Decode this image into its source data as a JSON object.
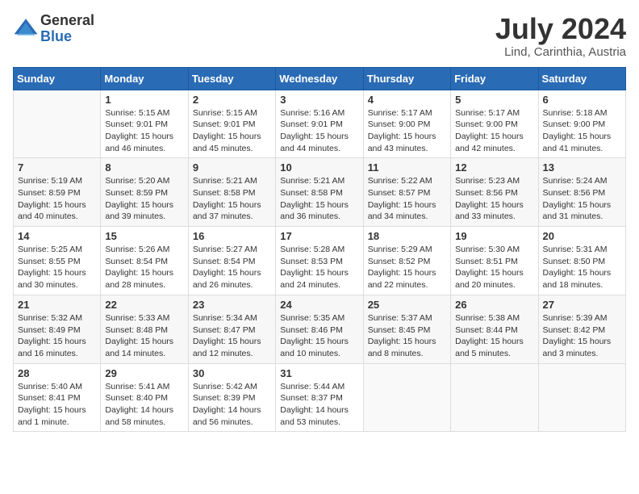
{
  "header": {
    "logo_general": "General",
    "logo_blue": "Blue",
    "month_title": "July 2024",
    "location": "Lind, Carinthia, Austria"
  },
  "days_of_week": [
    "Sunday",
    "Monday",
    "Tuesday",
    "Wednesday",
    "Thursday",
    "Friday",
    "Saturday"
  ],
  "weeks": [
    [
      {
        "day": "",
        "empty": true
      },
      {
        "day": "1",
        "sunrise": "5:15 AM",
        "sunset": "9:01 PM",
        "daylight": "15 hours and 46 minutes."
      },
      {
        "day": "2",
        "sunrise": "5:15 AM",
        "sunset": "9:01 PM",
        "daylight": "15 hours and 45 minutes."
      },
      {
        "day": "3",
        "sunrise": "5:16 AM",
        "sunset": "9:01 PM",
        "daylight": "15 hours and 44 minutes."
      },
      {
        "day": "4",
        "sunrise": "5:17 AM",
        "sunset": "9:00 PM",
        "daylight": "15 hours and 43 minutes."
      },
      {
        "day": "5",
        "sunrise": "5:17 AM",
        "sunset": "9:00 PM",
        "daylight": "15 hours and 42 minutes."
      },
      {
        "day": "6",
        "sunrise": "5:18 AM",
        "sunset": "9:00 PM",
        "daylight": "15 hours and 41 minutes."
      }
    ],
    [
      {
        "day": "7",
        "sunrise": "5:19 AM",
        "sunset": "8:59 PM",
        "daylight": "15 hours and 40 minutes."
      },
      {
        "day": "8",
        "sunrise": "5:20 AM",
        "sunset": "8:59 PM",
        "daylight": "15 hours and 39 minutes."
      },
      {
        "day": "9",
        "sunrise": "5:21 AM",
        "sunset": "8:58 PM",
        "daylight": "15 hours and 37 minutes."
      },
      {
        "day": "10",
        "sunrise": "5:21 AM",
        "sunset": "8:58 PM",
        "daylight": "15 hours and 36 minutes."
      },
      {
        "day": "11",
        "sunrise": "5:22 AM",
        "sunset": "8:57 PM",
        "daylight": "15 hours and 34 minutes."
      },
      {
        "day": "12",
        "sunrise": "5:23 AM",
        "sunset": "8:56 PM",
        "daylight": "15 hours and 33 minutes."
      },
      {
        "day": "13",
        "sunrise": "5:24 AM",
        "sunset": "8:56 PM",
        "daylight": "15 hours and 31 minutes."
      }
    ],
    [
      {
        "day": "14",
        "sunrise": "5:25 AM",
        "sunset": "8:55 PM",
        "daylight": "15 hours and 30 minutes."
      },
      {
        "day": "15",
        "sunrise": "5:26 AM",
        "sunset": "8:54 PM",
        "daylight": "15 hours and 28 minutes."
      },
      {
        "day": "16",
        "sunrise": "5:27 AM",
        "sunset": "8:54 PM",
        "daylight": "15 hours and 26 minutes."
      },
      {
        "day": "17",
        "sunrise": "5:28 AM",
        "sunset": "8:53 PM",
        "daylight": "15 hours and 24 minutes."
      },
      {
        "day": "18",
        "sunrise": "5:29 AM",
        "sunset": "8:52 PM",
        "daylight": "15 hours and 22 minutes."
      },
      {
        "day": "19",
        "sunrise": "5:30 AM",
        "sunset": "8:51 PM",
        "daylight": "15 hours and 20 minutes."
      },
      {
        "day": "20",
        "sunrise": "5:31 AM",
        "sunset": "8:50 PM",
        "daylight": "15 hours and 18 minutes."
      }
    ],
    [
      {
        "day": "21",
        "sunrise": "5:32 AM",
        "sunset": "8:49 PM",
        "daylight": "15 hours and 16 minutes."
      },
      {
        "day": "22",
        "sunrise": "5:33 AM",
        "sunset": "8:48 PM",
        "daylight": "15 hours and 14 minutes."
      },
      {
        "day": "23",
        "sunrise": "5:34 AM",
        "sunset": "8:47 PM",
        "daylight": "15 hours and 12 minutes."
      },
      {
        "day": "24",
        "sunrise": "5:35 AM",
        "sunset": "8:46 PM",
        "daylight": "15 hours and 10 minutes."
      },
      {
        "day": "25",
        "sunrise": "5:37 AM",
        "sunset": "8:45 PM",
        "daylight": "15 hours and 8 minutes."
      },
      {
        "day": "26",
        "sunrise": "5:38 AM",
        "sunset": "8:44 PM",
        "daylight": "15 hours and 5 minutes."
      },
      {
        "day": "27",
        "sunrise": "5:39 AM",
        "sunset": "8:42 PM",
        "daylight": "15 hours and 3 minutes."
      }
    ],
    [
      {
        "day": "28",
        "sunrise": "5:40 AM",
        "sunset": "8:41 PM",
        "daylight": "15 hours and 1 minute."
      },
      {
        "day": "29",
        "sunrise": "5:41 AM",
        "sunset": "8:40 PM",
        "daylight": "14 hours and 58 minutes."
      },
      {
        "day": "30",
        "sunrise": "5:42 AM",
        "sunset": "8:39 PM",
        "daylight": "14 hours and 56 minutes."
      },
      {
        "day": "31",
        "sunrise": "5:44 AM",
        "sunset": "8:37 PM",
        "daylight": "14 hours and 53 minutes."
      },
      {
        "day": "",
        "empty": true
      },
      {
        "day": "",
        "empty": true
      },
      {
        "day": "",
        "empty": true
      }
    ]
  ],
  "labels": {
    "sunrise": "Sunrise:",
    "sunset": "Sunset:",
    "daylight": "Daylight:"
  }
}
